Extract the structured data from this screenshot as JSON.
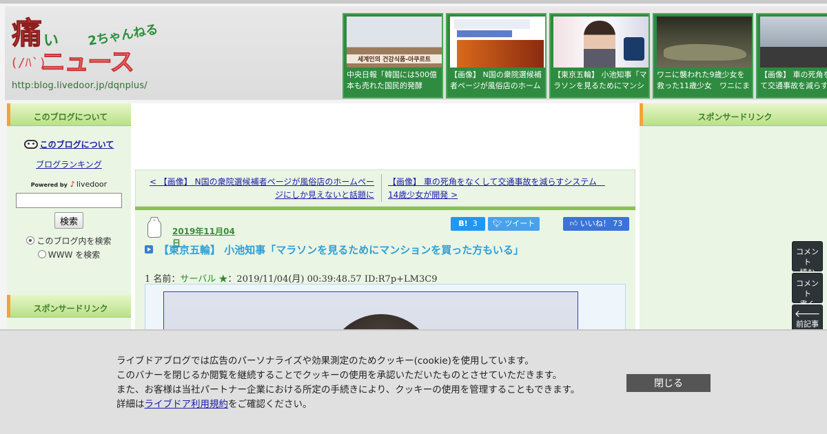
{
  "header": {
    "logo_main": "痛",
    "logo_kana": "い",
    "logo_chan": "2ちゃんねる",
    "logo_face": "(/ﾊ`)",
    "logo_news": "ニュース",
    "logo_url": "http:blog.livedoor.jp/dqnplus/"
  },
  "thumbs": [
    {
      "caption": "中央日報「韓国には500億本も売れた国民的発酵",
      "overlay_text": "세계인의 건강식품-아쿠르트"
    },
    {
      "caption": "【画像】 N国の衆院選候補者ページが風俗店のホーム"
    },
    {
      "caption": "【東京五輪】 小池知事「マラソンを見るためにマンシ"
    },
    {
      "caption": "ワニに襲われた9歳少女を救った11歳少女　ワニにま"
    },
    {
      "caption": "【画像】 車の死角をなくして交通事故を減らす"
    }
  ],
  "left_sidebar": {
    "about_heading": "このブログについて",
    "about_link": "このブログについて",
    "ranking_link": "ブログランキング",
    "powered_by": "Powered by",
    "powered_brand": "livedoor",
    "search_button": "検索",
    "radio_blog": "このブログ内を検索",
    "radio_www": "WWW を検索",
    "sponsored_heading": "スポンサードリンク"
  },
  "right_sidebar": {
    "sponsored_heading": "スポンサードリンク"
  },
  "nav": {
    "prev": "< 【画像】 N国の衆院選候補者ページが風俗店のホームページにしか見えないと話題に",
    "next": "【画像】 車の死角をなくして交通事故を減らすシステム　14歳少女が開発 >"
  },
  "article": {
    "date": "2019年11月04日",
    "hatena_label": "B!",
    "hatena_count": "3",
    "tweet_label": "ツイート",
    "like_label": "いいね！",
    "like_count": "73",
    "title": "【東京五輪】 小池知事「マラソンを見るためにマンションを買った方もいる」",
    "post_number": "1 名前：",
    "post_name": "サーバル ★",
    "post_meta": "：2019/11/04(月) 00:39:48.57 ID:R7p+LM3C9"
  },
  "float_buttons": {
    "read_comments": "コメント\n読む",
    "write_comment": "コメント\n書く",
    "prev_article": "前記事"
  },
  "cookie": {
    "line1": "ライブドアブログでは広告のパーソナライズや効果測定のためクッキー(cookie)を使用しています。",
    "line2": "このバナーを閉じるか閲覧を継続することでクッキーの使用を承認いただいたものとさせていただきます。",
    "line3": "また、お客様は当社パートナー企業における所定の手続きにより、クッキーの使用を管理することもできます。",
    "line4_prefix": "詳細は",
    "line4_link": "ライブドア利用規約",
    "line4_suffix": "をご確認ください。",
    "close_button": "閉じる"
  },
  "colors": {
    "accent_green": "#8cc152",
    "sidebar_bg": "#eaf5e4",
    "title_blue": "#2f9fd6",
    "thumb_green": "#2e8b3f",
    "sidebar_tab_orange": "#f3a33a"
  }
}
